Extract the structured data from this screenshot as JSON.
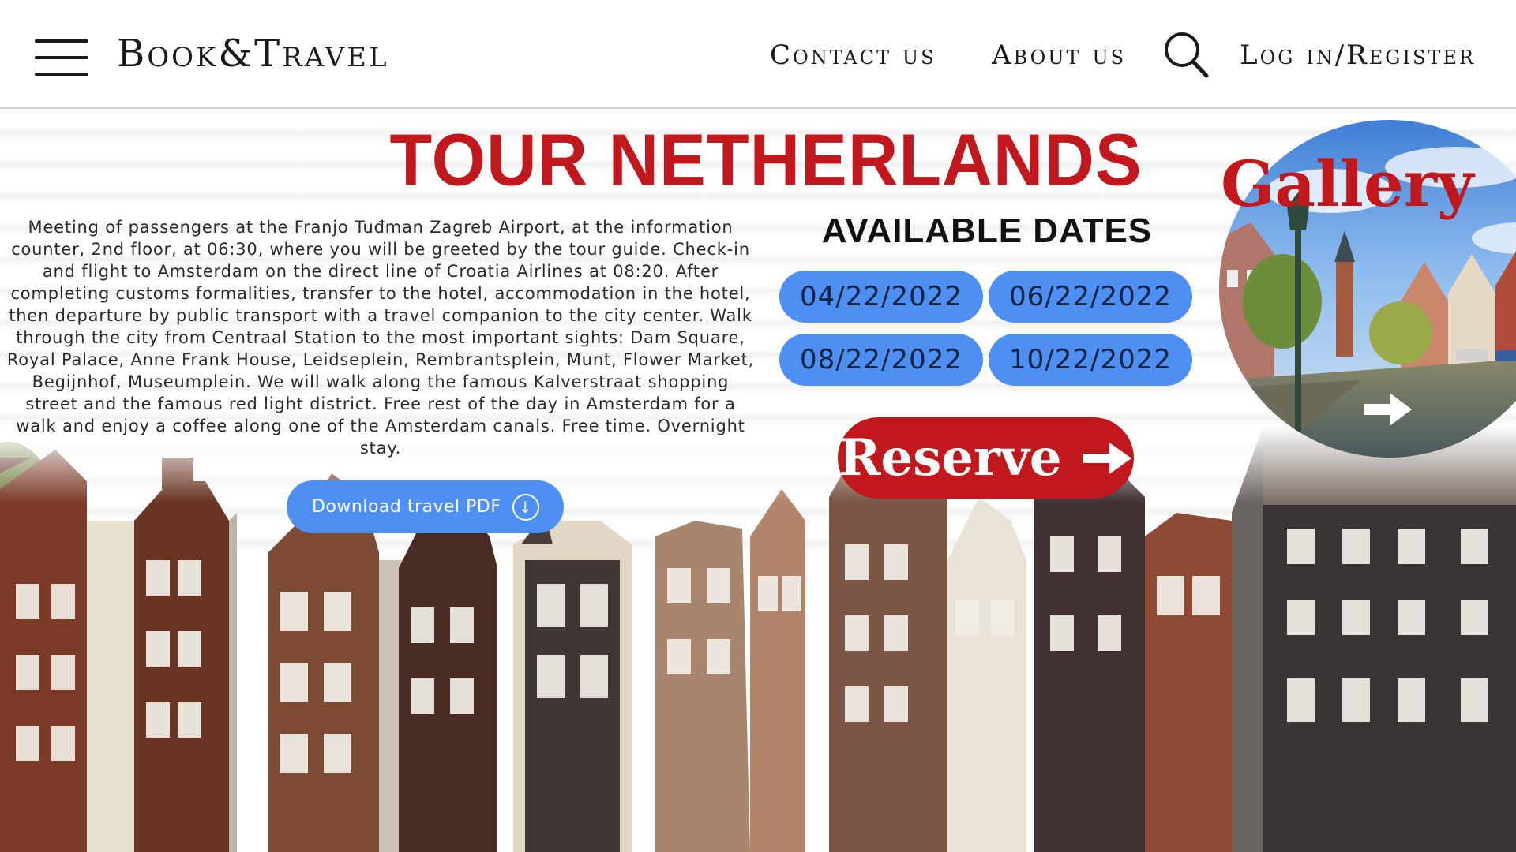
{
  "header": {
    "brand": "Book&Travel",
    "nav": {
      "contact": "Contact us",
      "about": "About us",
      "login": "Log in/Register"
    }
  },
  "main": {
    "title": "TOUR NETHERLANDS",
    "description": "Meeting of passengers at the Franjo Tuđman Zagreb Airport, at the information counter, 2nd floor, at 06:30, where you will be greeted by the tour guide. Check-in and flight to Amsterdam on the direct line of Croatia Airlines at 08:20. After completing customs formalities, transfer to the hotel, accommodation in the hotel, then departure by public transport with a travel companion to the city center. Walk through the city from Centraal Station to the most important sights: Dam Square, Royal Palace, Anne Frank House, Leidseplein, Rembrantsplein, Munt, Flower Market, Begijnhof, Museumplein. We will walk along the famous Kalverstraat shopping street and the famous red light district. Free rest of the day in Amsterdam for a walk and enjoy a coffee along one of the Amsterdam canals. Free time. Overnight stay.",
    "download_label": "Download travel PDF"
  },
  "dates": {
    "title": "AVAILABLE DATES",
    "items": [
      "04/22/2022",
      "06/22/2022",
      "08/22/2022",
      "10/22/2022"
    ]
  },
  "reserve": {
    "label": "Reserve"
  },
  "gallery": {
    "label": "Gallery"
  },
  "colors": {
    "accent_red": "#c1181d",
    "button_blue": "#4d8ff3"
  },
  "icons": [
    "hamburger-menu-icon",
    "search-icon",
    "download-icon",
    "arrow-right-icon",
    "gallery-next-icon"
  ]
}
